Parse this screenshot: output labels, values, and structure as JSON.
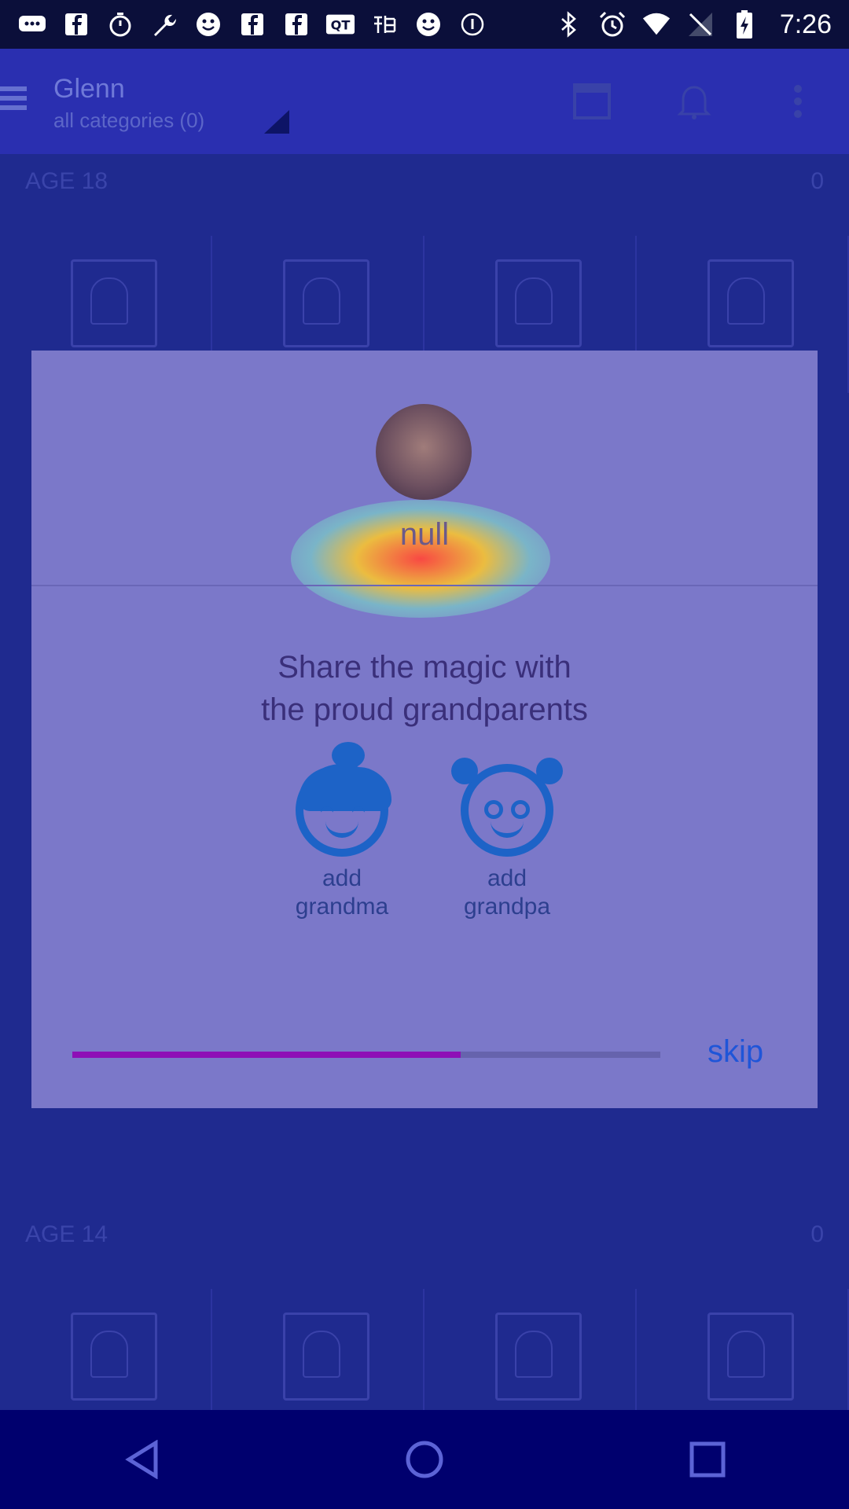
{
  "status_bar": {
    "time": "7:26",
    "left_icons": [
      "chat-icon",
      "facebook-icon",
      "timer-icon",
      "wrench-icon",
      "smiley-icon",
      "facebook-icon",
      "facebook-icon",
      "qq-icon",
      "chinese-app-icon",
      "smiley-icon",
      "alarm-icon"
    ],
    "right_icons": [
      "bluetooth-icon",
      "alarm-clock-icon",
      "wifi-icon",
      "signal-icon",
      "battery-charging-icon"
    ]
  },
  "header": {
    "title": "Glenn",
    "subtitle": "all categories (0)"
  },
  "sections": [
    {
      "label": "AGE 18",
      "count": "0"
    },
    {
      "label": "AGE 14",
      "count": "0"
    }
  ],
  "dialog": {
    "user_name": "null",
    "heading_line1": "Share the magic with",
    "heading_line2": "the proud grandparents",
    "grandma_line1": "add",
    "grandma_line2": "grandma",
    "grandpa_line1": "add",
    "grandpa_line2": "grandpa",
    "progress": 0.66,
    "skip_label": "skip"
  },
  "colors": {
    "accent": "#1d63c7",
    "progress": "#8e0fb6",
    "dialog_bg": "#7b78c9"
  }
}
